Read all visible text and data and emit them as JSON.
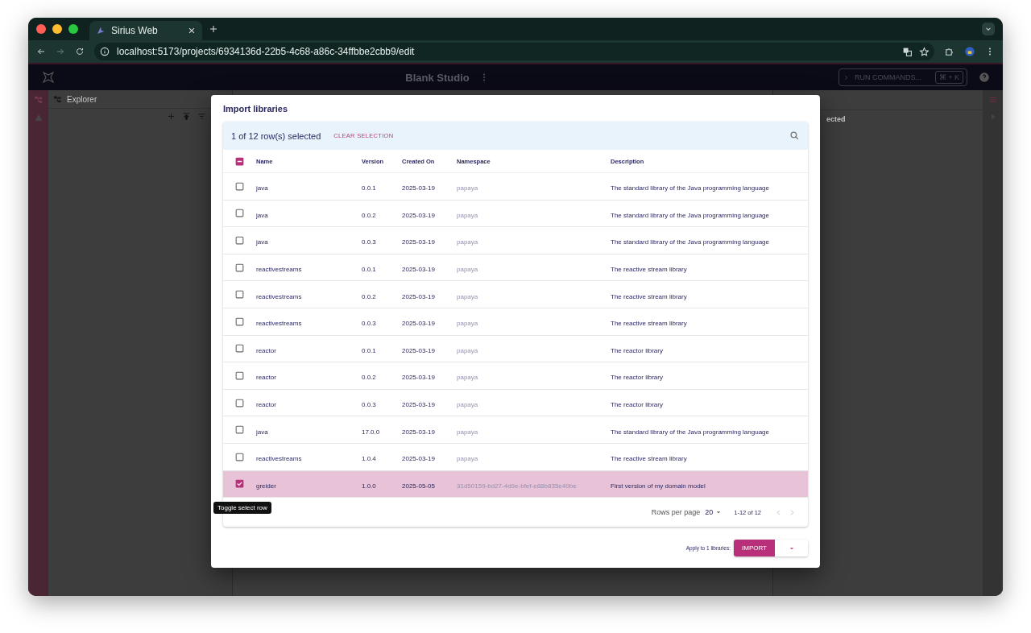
{
  "browser": {
    "tabs": [
      {
        "title": "Sirius Web",
        "selected": true
      }
    ],
    "url": "localhost:5173/projects/6934136d-22b5-4c68-a86c-34ffbbe2cbb9/edit"
  },
  "app": {
    "title": "Blank Studio",
    "command_placeholder": "RUN COMMANDS...",
    "shortcut": "⌘ + K",
    "explorer_title": "Explorer",
    "right_panel_text": "ected"
  },
  "dialog": {
    "title": "Import libraries",
    "toolbar": {
      "selection_text": "1 of 12 row(s) selected",
      "clear_label": "CLEAR SELECTION"
    },
    "header_checkbox": {
      "indeterminate": true
    },
    "columns": [
      "Name",
      "Version",
      "Created On",
      "Namespace",
      "Description"
    ],
    "rows": [
      {
        "name": "java",
        "version": "0.0.1",
        "created_on": "2025-03-19",
        "namespace": "papaya",
        "description": "The standard library of the Java programming language",
        "selected": false
      },
      {
        "name": "java",
        "version": "0.0.2",
        "created_on": "2025-03-19",
        "namespace": "papaya",
        "description": "The standard library of the Java programming language",
        "selected": false
      },
      {
        "name": "java",
        "version": "0.0.3",
        "created_on": "2025-03-19",
        "namespace": "papaya",
        "description": "The standard library of the Java programming language",
        "selected": false
      },
      {
        "name": "reactivestreams",
        "version": "0.0.1",
        "created_on": "2025-03-19",
        "namespace": "papaya",
        "description": "The reactive stream library",
        "selected": false
      },
      {
        "name": "reactivestreams",
        "version": "0.0.2",
        "created_on": "2025-03-19",
        "namespace": "papaya",
        "description": "The reactive stream library",
        "selected": false
      },
      {
        "name": "reactivestreams",
        "version": "0.0.3",
        "created_on": "2025-03-19",
        "namespace": "papaya",
        "description": "The reactive stream library",
        "selected": false
      },
      {
        "name": "reactor",
        "version": "0.0.1",
        "created_on": "2025-03-19",
        "namespace": "papaya",
        "description": "The reactor library",
        "selected": false
      },
      {
        "name": "reactor",
        "version": "0.0.2",
        "created_on": "2025-03-19",
        "namespace": "papaya",
        "description": "The reactor library",
        "selected": false
      },
      {
        "name": "reactor",
        "version": "0.0.3",
        "created_on": "2025-03-19",
        "namespace": "papaya",
        "description": "The reactor library",
        "selected": false
      },
      {
        "name": "java",
        "version": "17.0.0",
        "created_on": "2025-03-19",
        "namespace": "papaya",
        "description": "The standard library of the Java programming language",
        "selected": false
      },
      {
        "name": "reactivestreams",
        "version": "1.0.4",
        "created_on": "2025-03-19",
        "namespace": "papaya",
        "description": "The reactive stream library",
        "selected": false
      },
      {
        "name": "greider",
        "version": "1.0.0",
        "created_on": "2025-05-05",
        "namespace": "31d50159-bd27-4d9e-bfef-e88b835e40be",
        "description": "First version of my domain model",
        "selected": true
      }
    ],
    "pagination": {
      "rows_per_page_label": "Rows per page",
      "rows_per_page": "20",
      "range": "1-12 of 12"
    },
    "footer": {
      "apply_label": "Apply to 1 libraries:",
      "import_label": "IMPORT"
    },
    "tooltip": "Toggle select row"
  }
}
